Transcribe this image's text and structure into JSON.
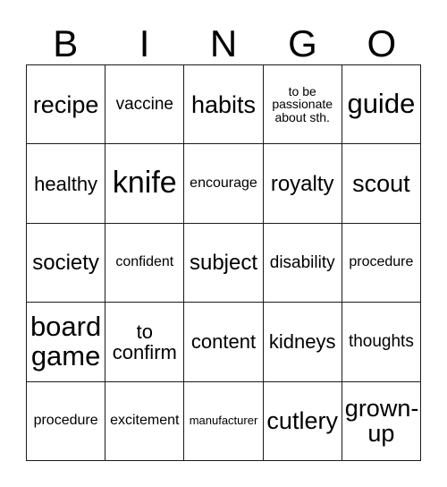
{
  "card": {
    "header_letters": [
      "B",
      "I",
      "N",
      "G",
      "O"
    ],
    "colors": {
      "background": "#ffffff",
      "text": "#000000",
      "border": "#1a1a1a"
    },
    "rows": [
      [
        {
          "text": "recipe",
          "size": "fs-lg"
        },
        {
          "text": "vaccine",
          "size": "fs-sm"
        },
        {
          "text": "habits",
          "size": "fs-lg"
        },
        {
          "text": "to be\npassionate\nabout sth.",
          "size": "fs-xxs"
        },
        {
          "text": "guide",
          "size": "fs-xl"
        }
      ],
      [
        {
          "text": "healthy",
          "size": "fs-md"
        },
        {
          "text": "knife",
          "size": "fs-xxl"
        },
        {
          "text": "encourage",
          "size": "fs-xs"
        },
        {
          "text": "royalty",
          "size": "fs-mdl"
        },
        {
          "text": "scout",
          "size": "fs-lg"
        }
      ],
      [
        {
          "text": "society",
          "size": "fs-mdl"
        },
        {
          "text": "confident",
          "size": "fs-xs"
        },
        {
          "text": "subject",
          "size": "fs-mdl"
        },
        {
          "text": "disability",
          "size": "fs-sm"
        },
        {
          "text": "procedure",
          "size": "fs-xs"
        }
      ],
      [
        {
          "text": "board\ngame",
          "size": "fs-xl"
        },
        {
          "text": "to\nconfirm",
          "size": "fs-md"
        },
        {
          "text": "content",
          "size": "fs-md"
        },
        {
          "text": "kidneys",
          "size": "fs-md"
        },
        {
          "text": "thoughts",
          "size": "fs-sm"
        }
      ],
      [
        {
          "text": "procedure",
          "size": "fs-xs"
        },
        {
          "text": "excitement",
          "size": "fs-xs"
        },
        {
          "text": "manufacturer",
          "size": "fs-tiny"
        },
        {
          "text": "cutlery",
          "size": "fs-lg"
        },
        {
          "text": "grown-\nup",
          "size": "fs-lg"
        }
      ]
    ]
  }
}
